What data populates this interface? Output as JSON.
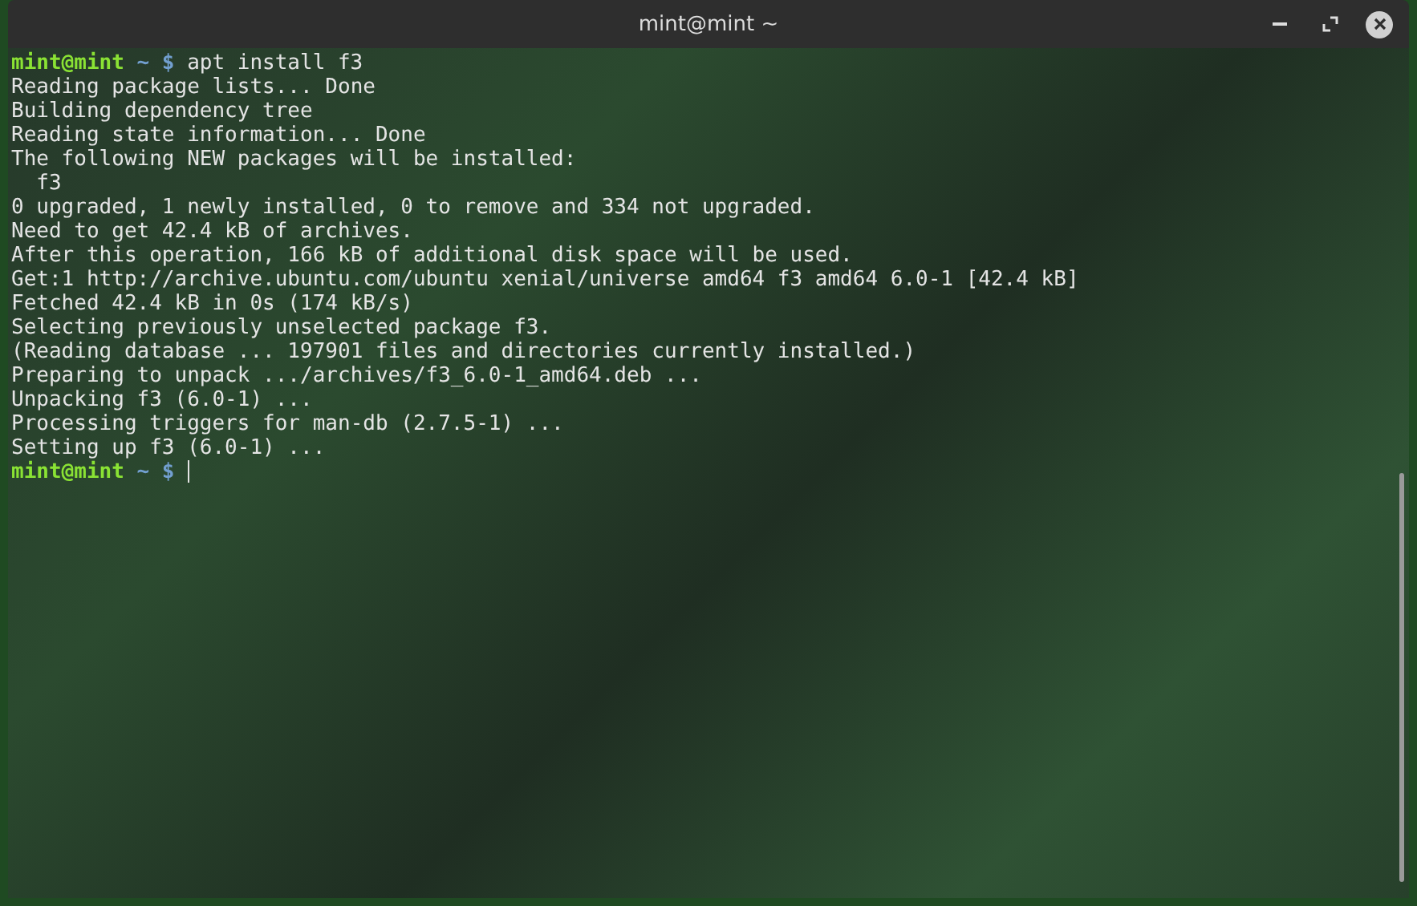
{
  "window": {
    "title": "mint@mint ~"
  },
  "terminal": {
    "lines": [
      {
        "kind": "prompt",
        "user": "mint@mint",
        "path": "~",
        "symbol": "$",
        "command": "apt install f3",
        "cursor": false
      },
      {
        "kind": "output",
        "text": "Reading package lists... Done"
      },
      {
        "kind": "output",
        "text": "Building dependency tree"
      },
      {
        "kind": "output",
        "text": "Reading state information... Done"
      },
      {
        "kind": "output",
        "text": "The following NEW packages will be installed:"
      },
      {
        "kind": "output",
        "text": "  f3"
      },
      {
        "kind": "output",
        "text": "0 upgraded, 1 newly installed, 0 to remove and 334 not upgraded."
      },
      {
        "kind": "output",
        "text": "Need to get 42.4 kB of archives."
      },
      {
        "kind": "output",
        "text": "After this operation, 166 kB of additional disk space will be used."
      },
      {
        "kind": "output",
        "text": "Get:1 http://archive.ubuntu.com/ubuntu xenial/universe amd64 f3 amd64 6.0-1 [42.4 kB]"
      },
      {
        "kind": "output",
        "text": "Fetched 42.4 kB in 0s (174 kB/s)"
      },
      {
        "kind": "output",
        "text": "Selecting previously unselected package f3."
      },
      {
        "kind": "output",
        "text": "(Reading database ... 197901 files and directories currently installed.)"
      },
      {
        "kind": "output",
        "text": "Preparing to unpack .../archives/f3_6.0-1_amd64.deb ..."
      },
      {
        "kind": "output",
        "text": "Unpacking f3 (6.0-1) ..."
      },
      {
        "kind": "output",
        "text": "Processing triggers for man-db (2.7.5-1) ..."
      },
      {
        "kind": "output",
        "text": "Setting up f3 (6.0-1) ..."
      },
      {
        "kind": "prompt",
        "user": "mint@mint",
        "path": "~",
        "symbol": "$",
        "cursor": true
      }
    ]
  }
}
